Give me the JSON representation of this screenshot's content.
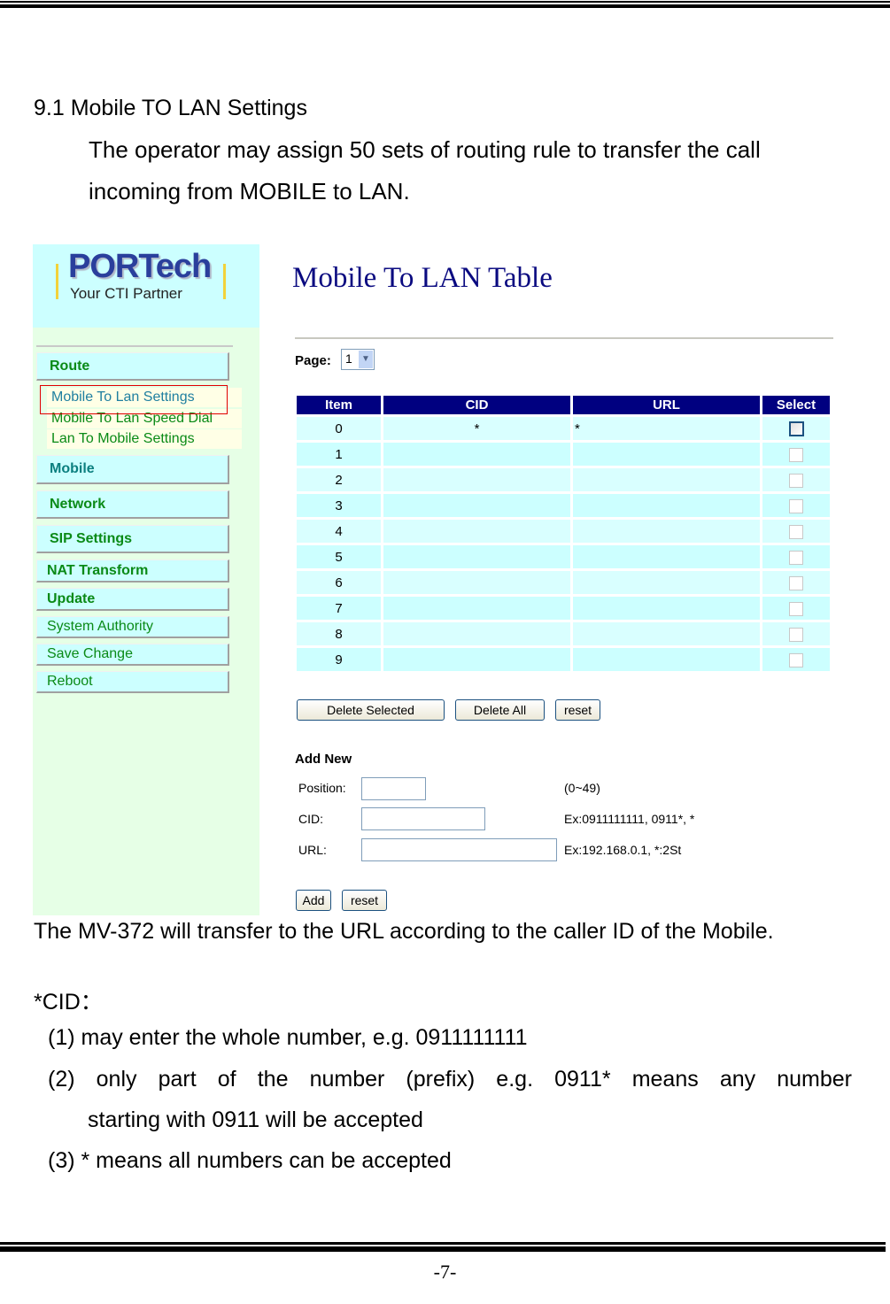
{
  "document": {
    "section_title": "9.1 Mobile TO LAN Settings",
    "intro": "The operator may assign 50 sets of routing rule to transfer the call incoming from MOBILE to LAN.",
    "caption": "The MV-372 will transfer to the URL according to the caller ID of the Mobile.",
    "cid_heading": "*CID：",
    "cid_notes": [
      "(1) may enter the whole number, e.g.  0911111111",
      "(2) only part of the number (prefix) e.g. 0911*  means any number",
      "starting with  0911 will be accepted",
      "(3)  *  means all numbers can be accepted"
    ],
    "page_number": "-7-"
  },
  "screenshot": {
    "logo": {
      "main": "PORTech",
      "tagline": "Your CTI Partner"
    },
    "sidebar": {
      "route": "Route",
      "route_sub": [
        "Mobile To Lan Settings",
        "Mobile To Lan Speed Dial",
        "Lan To Mobile Settings"
      ],
      "active_sub": "Mobile To Lan Settings",
      "items": [
        "Mobile",
        "Network",
        "SIP Settings",
        "NAT Transform",
        "Update",
        "System Authority",
        "Save Change",
        "Reboot"
      ]
    },
    "main": {
      "title": "Mobile To LAN Table",
      "page_label": "Page:",
      "page_value": "1",
      "table": {
        "headers": [
          "Item",
          "CID",
          "URL",
          "Select"
        ],
        "rows": [
          {
            "item": "0",
            "cid": "*",
            "url": "*",
            "selected": false
          },
          {
            "item": "1",
            "cid": "",
            "url": "",
            "selected": false
          },
          {
            "item": "2",
            "cid": "",
            "url": "",
            "selected": false
          },
          {
            "item": "3",
            "cid": "",
            "url": "",
            "selected": false
          },
          {
            "item": "4",
            "cid": "",
            "url": "",
            "selected": false
          },
          {
            "item": "5",
            "cid": "",
            "url": "",
            "selected": false
          },
          {
            "item": "6",
            "cid": "",
            "url": "",
            "selected": false
          },
          {
            "item": "7",
            "cid": "",
            "url": "",
            "selected": false
          },
          {
            "item": "8",
            "cid": "",
            "url": "",
            "selected": false
          },
          {
            "item": "9",
            "cid": "",
            "url": "",
            "selected": false
          }
        ]
      },
      "buttons": {
        "delete_selected": "Delete Selected",
        "delete_all": "Delete All",
        "reset": "reset"
      },
      "add_new": {
        "heading": "Add New",
        "position_label": "Position:",
        "position_value": "",
        "position_hint": "(0~49)",
        "cid_label": "CID:",
        "cid_value": "",
        "cid_hint": "Ex:0911111111,  0911*,  *",
        "url_label": "URL:",
        "url_value": "",
        "url_hint": "Ex:192.168.0.1,  *:2St",
        "add_button": "Add",
        "reset_button": "reset"
      }
    }
  }
}
